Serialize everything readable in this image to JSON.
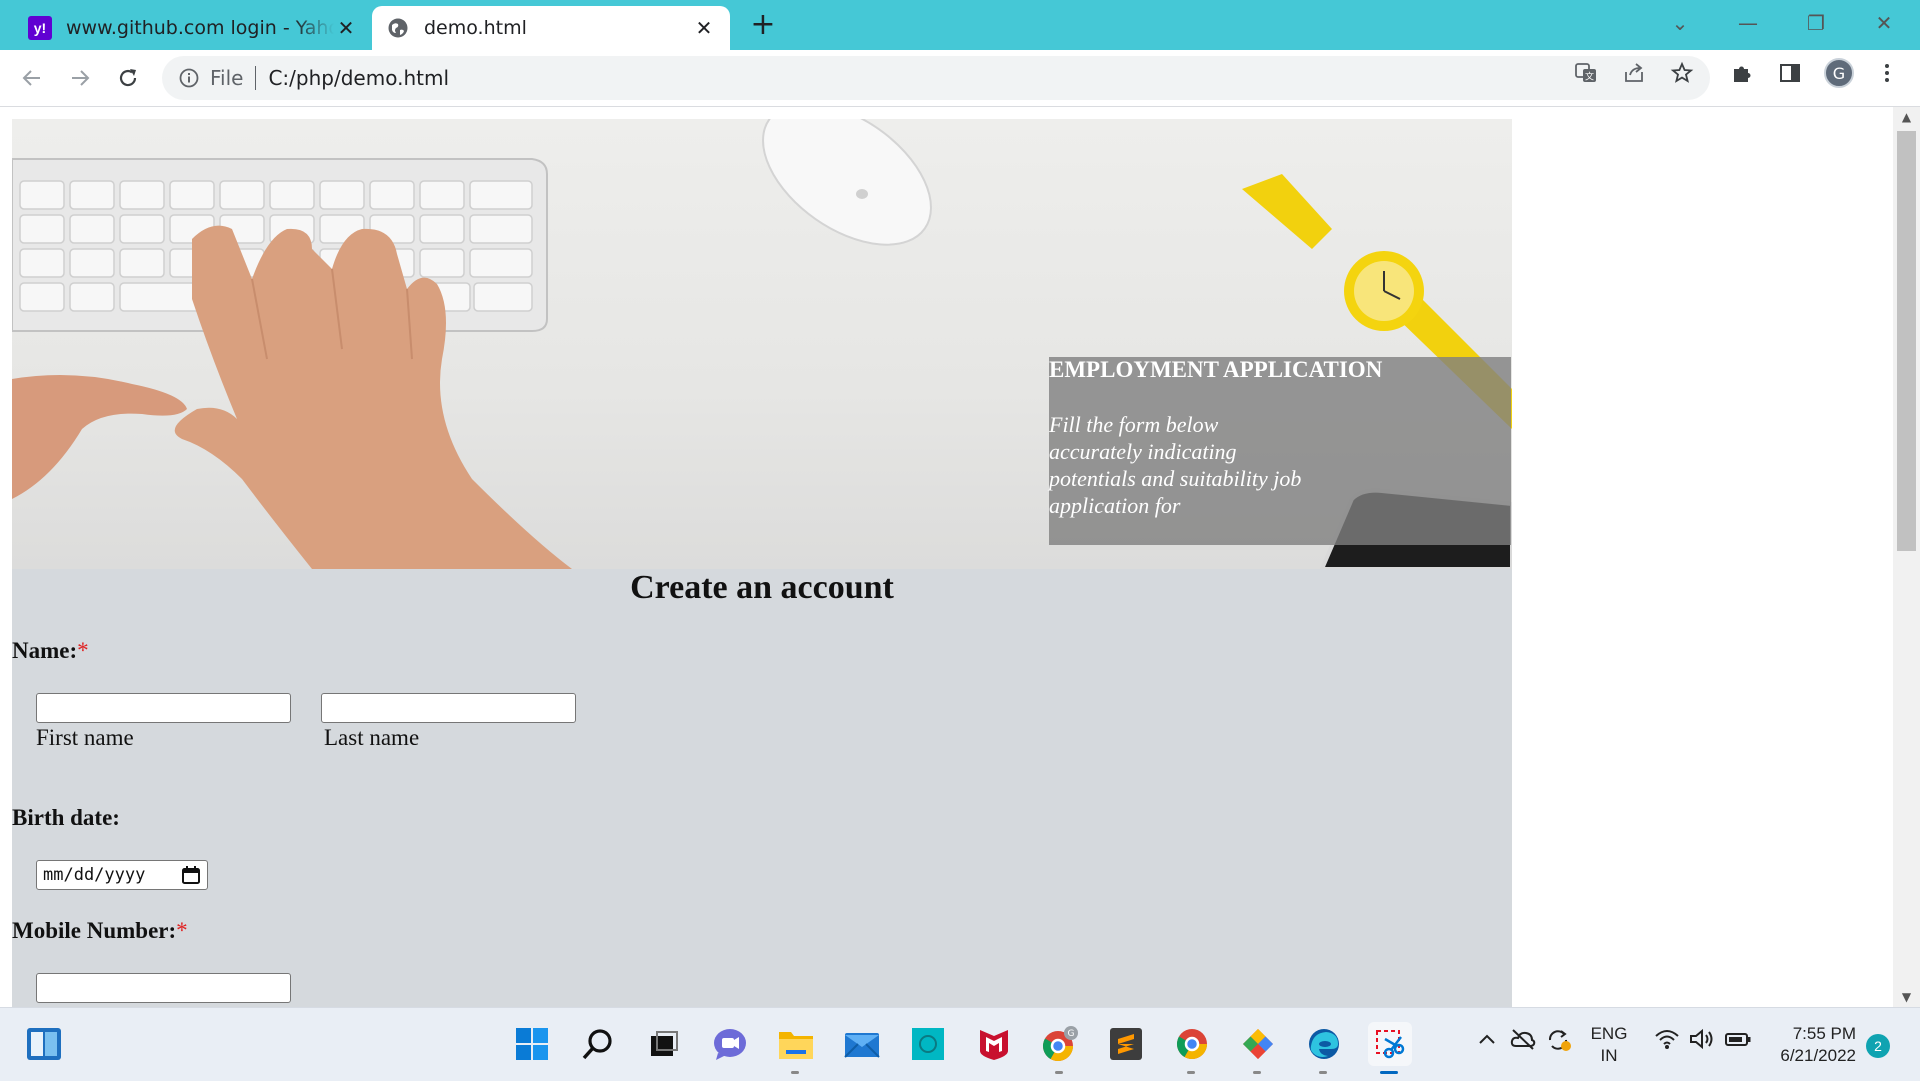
{
  "browser": {
    "tabs": [
      {
        "title": "www.github.com login - Yahoo Search",
        "active": false,
        "favicon": "yahoo-icon"
      },
      {
        "title": "demo.html",
        "active": true,
        "favicon": "globe-icon"
      }
    ],
    "address": {
      "scheme_label": "File",
      "url": "C:/php/demo.html"
    },
    "profile_initial": "G",
    "colors": {
      "tabstrip": "#45c8d6",
      "toolbar": "#ffffff",
      "omnibox": "#f1f3f4"
    }
  },
  "page": {
    "hero": {
      "heading": "EMPLOYMENT APPLICATION",
      "text": "Fill the form below accurately indicating potentials and suitability job application for"
    },
    "form": {
      "title": "Create an account",
      "name_label": "Name:",
      "required_mark": "*",
      "first_name_caption": "First name",
      "last_name_caption": "Last name",
      "birth_label": "Birth date:",
      "date_placeholder": "mm/dd/yyyy",
      "mobile_label": "Mobile Number:"
    },
    "colors": {
      "form_bg": "#d5d9dd",
      "required": "#e02020"
    }
  },
  "taskbar": {
    "apps": [
      "start-icon",
      "search-icon",
      "task-view-icon",
      "chat-icon",
      "file-explorer-icon",
      "mail-icon",
      "app-icon",
      "mcafee-icon",
      "chrome-icon",
      "sublime-text-icon",
      "chrome-icon",
      "git-icon",
      "edge-icon",
      "snipping-tool-icon"
    ],
    "language": "ENG",
    "region": "IN",
    "time": "7:55 PM",
    "date": "6/21/2022",
    "notifications": "2"
  }
}
